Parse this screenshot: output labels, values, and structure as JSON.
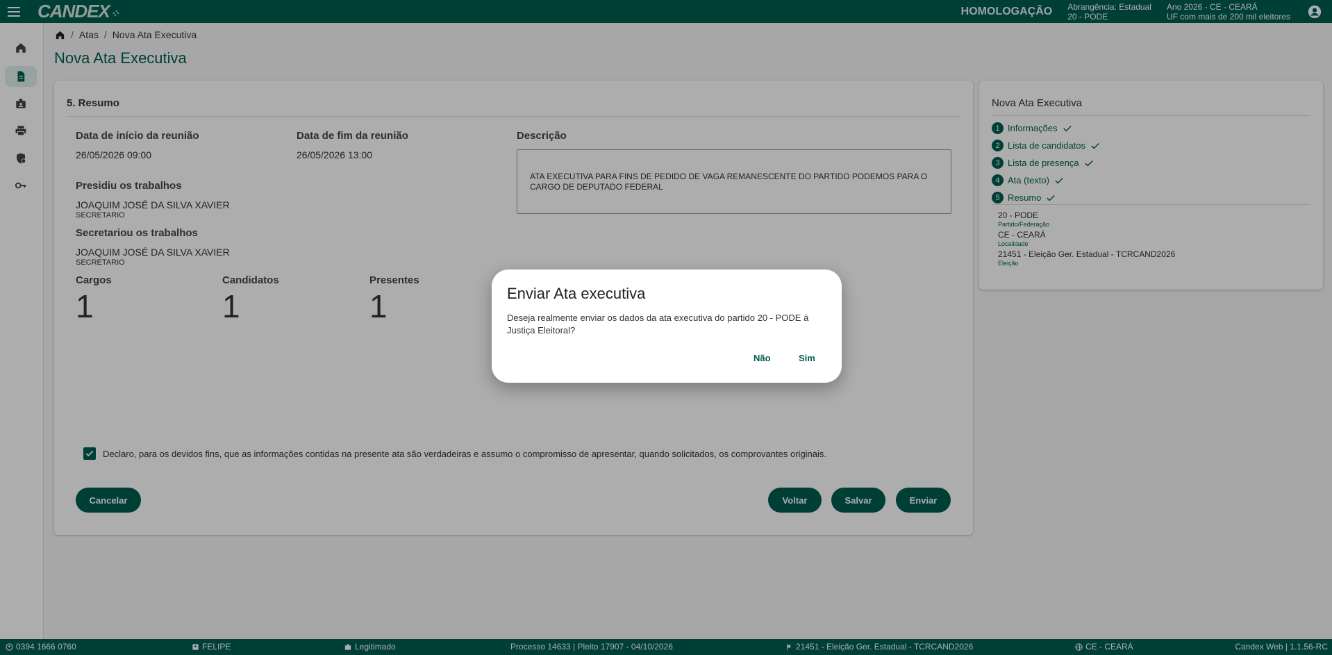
{
  "topbar": {
    "logo": "CANDEX",
    "environment": "HOMOLOGAÇÃO",
    "scope_line1": "Abrangência: Estadual",
    "scope_line2": "20 - PODE",
    "year_line1": "Ano 2026 - CE - CEARÁ",
    "year_line2": "UF com mais de 200 mil eleitores"
  },
  "sidebar": {
    "items": [
      "home-icon",
      "document-icon",
      "badge-icon",
      "print-icon",
      "shield-user-icon",
      "key-icon"
    ],
    "active": "document-icon"
  },
  "breadcrumb": {
    "items": [
      "Atas",
      "Nova Ata Executiva"
    ]
  },
  "page_title": "Nova Ata Executiva",
  "summary": {
    "section_title": "5. Resumo",
    "start_label": "Data de início da reunião",
    "start_value": "26/05/2026 09:00",
    "end_label": "Data de fim da reunião",
    "end_value": "26/05/2026 13:00",
    "description_label": "Descrição",
    "description_value": "ATA EXECUTIVA PARA FINS DE PEDIDO DE VAGA REMANESCENTE DO PARTIDO PODEMOS PARA O CARGO DE DEPUTADO FEDERAL",
    "presided_label": "Presidiu os trabalhos",
    "presided_name": "JOAQUIM JOSÉ DA SILVA XAVIER",
    "presided_role": "SECRETARIO",
    "secretary_label": "Secretariou os trabalhos",
    "secretary_name": "JOAQUIM JOSÉ DA SILVA XAVIER",
    "secretary_role": "SECRETARIO",
    "cargos_label": "Cargos",
    "cargos_value": "1",
    "candidatos_label": "Candidatos",
    "candidatos_value": "1",
    "presentes_label": "Presentes",
    "presentes_value": "1",
    "declaration": "Declaro, para os devidos fins, que as informações contidas na presente ata são verdadeiras e assumo o compromisso de apresentar, quando solicitados, os comprovantes originais.",
    "declaration_checked": true
  },
  "actions": {
    "cancel": "Cancelar",
    "back": "Voltar",
    "save": "Salvar",
    "send": "Enviar"
  },
  "steps_panel": {
    "title": "Nova Ata Executiva",
    "steps": [
      {
        "num": "1",
        "label": "Informações"
      },
      {
        "num": "2",
        "label": "Lista de candidatos"
      },
      {
        "num": "3",
        "label": "Lista de presença"
      },
      {
        "num": "4",
        "label": "Ata (texto)"
      },
      {
        "num": "5",
        "label": "Resumo"
      }
    ],
    "party_value": "20 - PODE",
    "party_label": "Partido/Federação",
    "location_value": "CE - CEARÁ",
    "location_label": "Localidade",
    "election_value": "21451 - Eleição Ger. Estadual - TCRCAND2026",
    "election_label": "Eleição"
  },
  "footer": {
    "phone": "0394 1666 0760",
    "user": "FELIPE",
    "status": "Legitimado",
    "process": "Processo 14633 | Pleito 17907 - 04/10/2026",
    "election": "21451 - Eleição Ger. Estadual - TCRCAND2026",
    "location": "CE - CEARÁ",
    "version": "Candex Web | 1.1.56-RC"
  },
  "dialog": {
    "title": "Enviar Ata executiva",
    "text": "Deseja realmente enviar os dados da ata executiva do partido 20 - PODE à Justiça Eleitoral?",
    "no": "Não",
    "yes": "Sim"
  },
  "colors": {
    "primary": "#005e50",
    "overlay": "rgba(0,0,0,0.32)"
  }
}
